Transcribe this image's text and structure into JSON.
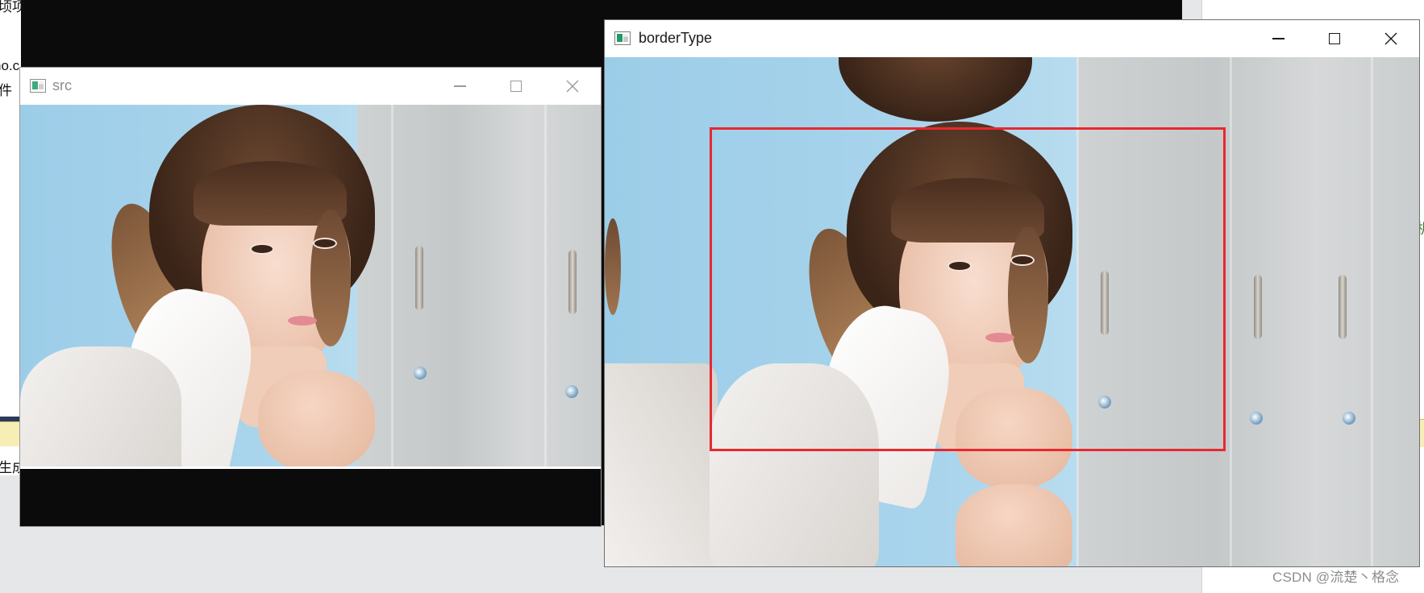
{
  "background": {
    "ide_left_fragments": [
      "顷项",
      "no.c",
      "件",
      "生成"
    ],
    "right_fragment": "机"
  },
  "windows": {
    "src": {
      "title": "src"
    },
    "borderType": {
      "title": "borderType"
    }
  },
  "controls": {
    "minimize": "minimize-icon",
    "maximize": "maximize-icon",
    "close": "close-icon"
  },
  "colors": {
    "annotation_rect": "#e8282f",
    "desktop_bg": "#e6e7e9",
    "window_black": "#0b0b0c"
  },
  "watermark": "CSDN @流楚丶格念"
}
